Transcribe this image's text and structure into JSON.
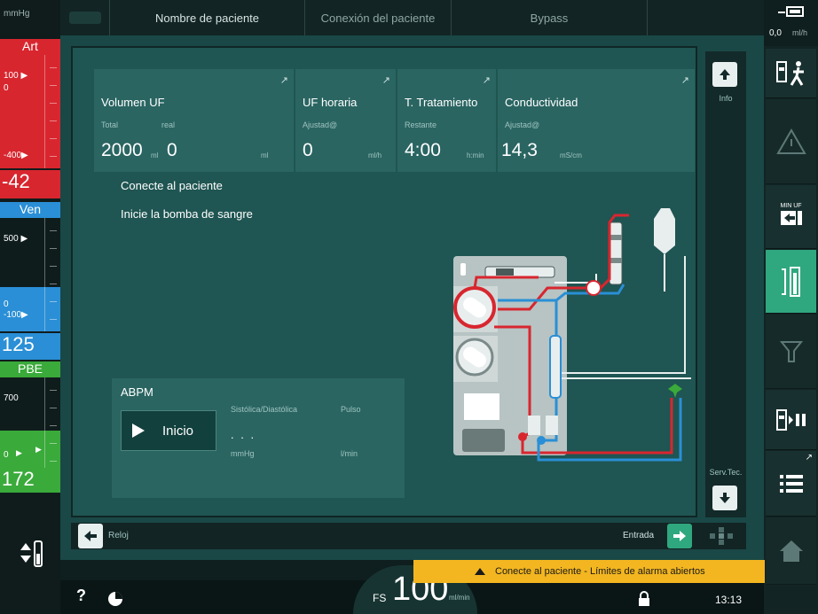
{
  "left": {
    "unit": "mmHg",
    "art": {
      "label": "Art",
      "top_tick": "100 ▶",
      "zero_tick": "0",
      "bottom_tick": "-400▶",
      "value": "-42"
    },
    "ven": {
      "label": "Ven",
      "top_tick": "500 ▶",
      "zero_tick": "0",
      "bottom_tick": "-100▶",
      "value": "125"
    },
    "pbe": {
      "label": "PBE",
      "top_tick": "700",
      "zero_tick": "0",
      "value": "172"
    }
  },
  "topbar": {
    "patient_name": "Nombre de paciente",
    "patient_connection": "Conexión del paciente",
    "bypass": "Bypass"
  },
  "right": {
    "uf_readout": "0,0",
    "uf_unit": "ml/h",
    "min_uf": "MIN UF"
  },
  "params": [
    {
      "title": "Volumen UF",
      "sub1": "Total",
      "sub2": "real",
      "val1": "2000",
      "unit1": "ml",
      "val2": "0",
      "unit2": "ml"
    },
    {
      "title": "UF horaria",
      "sub1": "Ajustad@",
      "val1": "0",
      "unit1": "ml/h"
    },
    {
      "title": "T. Tratamiento",
      "sub1": "Restante",
      "val1": "4:00",
      "unit1": "h:min"
    },
    {
      "title": "Conductividad",
      "sub1": "Ajustad@",
      "val1": "14,3",
      "unit1": "mS/cm"
    }
  ],
  "messages": [
    "Conecte al paciente",
    "Inicie la bomba de sangre"
  ],
  "abpm": {
    "title": "ABPM",
    "start": "Inicio",
    "systolic_diastolic": "Sistólica/Diastólica",
    "pulse": "Pulso",
    "dots": ". . .",
    "unit_mmhg": "mmHg",
    "unit_min": "l/min"
  },
  "scroll": {
    "info": "Info",
    "service": "Serv.Tec."
  },
  "bottombar": {
    "left": "Reloj",
    "right": "Entrada"
  },
  "status": {
    "help": "?",
    "fs": "FS",
    "flow": "100",
    "flow_unit": "ml/min",
    "time": "13:13",
    "alarm": "Conecte al paciente - Límites de alarma abiertos"
  },
  "colors": {
    "art": "#d8262f",
    "ven": "#2a8fd6",
    "pbe": "#3aaa3a",
    "accent": "#2fa77f",
    "alarm": "#f3b620"
  }
}
